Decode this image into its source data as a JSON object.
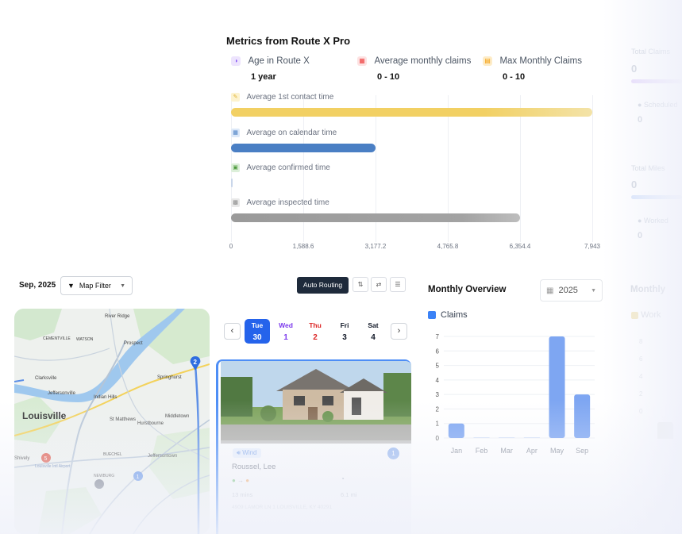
{
  "metrics": {
    "title": "Metrics from Route X Pro",
    "kpis": [
      {
        "label": "Age in Route X",
        "value": "1 year",
        "icon": "age-icon",
        "color": "#8b5cf6"
      },
      {
        "label": "Average monthly claims",
        "value": "0 - 10",
        "icon": "calendar-icon",
        "color": "#ef4444"
      },
      {
        "label": "Max Monthly Claims",
        "value": "0 - 10",
        "icon": "clipboard-icon",
        "color": "#f59e0b"
      }
    ],
    "bars": [
      {
        "label": "Average 1st contact time",
        "value": 7943,
        "color": "#f2d063",
        "icon": "contact-icon"
      },
      {
        "label": "Average on calendar time",
        "value": 3177.2,
        "color": "#4a7fc4",
        "icon": "calendar-icon"
      },
      {
        "label": "Average confirmed time",
        "value": 0,
        "color": "#4a7fc4",
        "icon": "confirmed-icon"
      },
      {
        "label": "Average inspected time",
        "value": 6354.4,
        "color": "#9a9a9a",
        "icon": "inspected-icon"
      }
    ],
    "ticks": [
      "0",
      "1,588.6",
      "3,177.2",
      "4,765.8",
      "6,354.4",
      "7,943"
    ],
    "max": 7943
  },
  "ghost": {
    "total_claims_label": "Total Claims",
    "total_claims_value": "0",
    "scheduled_label": "Scheduled",
    "scheduled_value": "0",
    "total_miles_label": "Total Miles",
    "total_miles_value": "0",
    "worked_label": "Worked",
    "worked_value": "0",
    "monthly_label": "Monthly",
    "work_label": "Work",
    "work_ticks": [
      "8",
      "6",
      "4",
      "2",
      "0"
    ]
  },
  "schedule": {
    "date_label": "Sep, 2025",
    "map_filter_label": "Map Filter",
    "auto_routing_label": "Auto Routing",
    "days": [
      {
        "name": "Tue",
        "num": "30",
        "selected": true
      },
      {
        "name": "Wed",
        "num": "1"
      },
      {
        "name": "Thu",
        "num": "2"
      },
      {
        "name": "Fri",
        "num": "3"
      },
      {
        "name": "Sat",
        "num": "4"
      }
    ]
  },
  "map": {
    "labels": [
      "River Ridge",
      "CEMENTVILLE",
      "WATSON",
      "Prospect",
      "Clarksville",
      "Jeffersonville",
      "Indian Hills",
      "Springhurst",
      "Louisville",
      "St Matthews",
      "Hurstbourne",
      "Middletown",
      "Jeffersontown",
      "Shively",
      "Louisville Intl Airport",
      "NEWBURG",
      "BUECHEL"
    ],
    "pin_a": "2",
    "pin_b": "1"
  },
  "property": {
    "tag": "Wind",
    "badge": "1",
    "owner": "Roussel, Lee",
    "time": "13 mins",
    "distance": "6.1 mi",
    "address": "4909 LAMOR LN 1 LOUISVILLE, KY 40291"
  },
  "monthly_overview": {
    "title": "Monthly Overview",
    "year": "2025",
    "legend": "Claims"
  },
  "chart_data": {
    "type": "bar",
    "categories": [
      "Jan",
      "Feb",
      "Mar",
      "Apr",
      "May",
      "Sep"
    ],
    "series": [
      {
        "name": "Claims",
        "values": [
          1,
          0,
          0,
          0,
          7,
          3
        ]
      }
    ],
    "ylim": [
      0,
      7
    ],
    "yticks": [
      "0",
      "1",
      "2",
      "3",
      "4",
      "5",
      "6",
      "7"
    ],
    "color": "#7ea6f2"
  }
}
